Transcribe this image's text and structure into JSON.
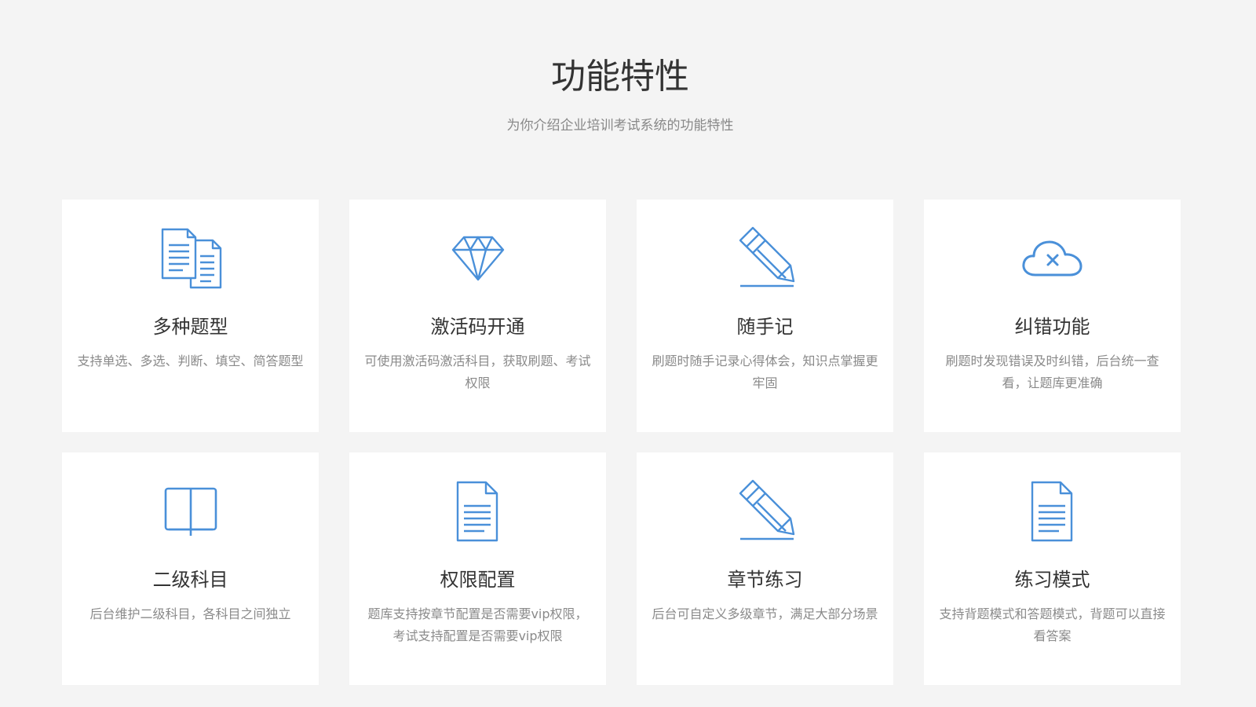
{
  "header": {
    "title": "功能特性",
    "subtitle": "为你介绍企业培训考试系统的功能特性"
  },
  "accent_color": "#4a90d9",
  "features": [
    {
      "icon": "documents-icon",
      "title": "多种题型",
      "desc": "支持单选、多选、判断、填空、简答题型"
    },
    {
      "icon": "diamond-icon",
      "title": "激活码开通",
      "desc": "可使用激活码激活科目，获取刷题、考试权限"
    },
    {
      "icon": "pencil-icon",
      "title": "随手记",
      "desc": "刷题时随手记录心得体会，知识点掌握更牢固"
    },
    {
      "icon": "cloud-error-icon",
      "title": "纠错功能",
      "desc": "刷题时发现错误及时纠错，后台统一查看，让题库更准确"
    },
    {
      "icon": "book-icon",
      "title": "二级科目",
      "desc": "后台维护二级科目，各科目之间独立"
    },
    {
      "icon": "document-icon",
      "title": "权限配置",
      "desc": "题库支持按章节配置是否需要vip权限，考试支持配置是否需要vip权限"
    },
    {
      "icon": "pencil-icon",
      "title": "章节练习",
      "desc": "后台可自定义多级章节，满足大部分场景"
    },
    {
      "icon": "document-icon",
      "title": "练习模式",
      "desc": "支持背题模式和答题模式，背题可以直接看答案"
    }
  ]
}
